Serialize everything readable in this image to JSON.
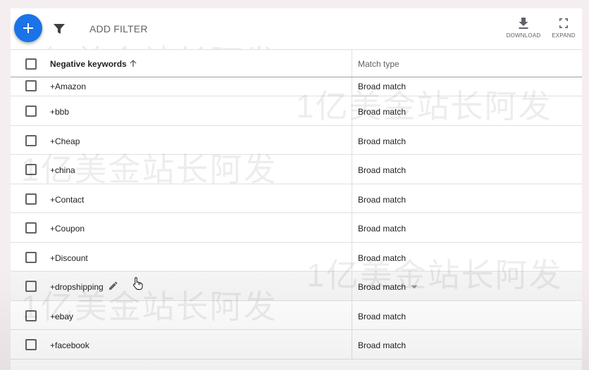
{
  "toolbar": {
    "add_label": "+",
    "add_filter_label": "ADD FILTER",
    "download_label": "DOWNLOAD",
    "expand_label": "EXPAND"
  },
  "table": {
    "columns": [
      "Negative keywords",
      "Match type"
    ],
    "rows": [
      {
        "keyword": "+Amazon",
        "match": "Broad match"
      },
      {
        "keyword": "+bbb",
        "match": "Broad match"
      },
      {
        "keyword": "+Cheap",
        "match": "Broad match"
      },
      {
        "keyword": "+china",
        "match": "Broad match"
      },
      {
        "keyword": "+Contact",
        "match": "Broad match"
      },
      {
        "keyword": "+Coupon",
        "match": "Broad match"
      },
      {
        "keyword": "+Discount",
        "match": "Broad match"
      },
      {
        "keyword": "+dropshipping",
        "match": "Broad match"
      },
      {
        "keyword": "+ebay",
        "match": "Broad match"
      },
      {
        "keyword": "+facebook",
        "match": "Broad match"
      }
    ]
  },
  "watermark": "1亿美金站长阿发",
  "colors": {
    "accent": "#1a73e8",
    "text": "#202124",
    "muted": "#5f6368",
    "divider": "#e0e0e0"
  },
  "icons": {
    "add": "plus-icon",
    "filter": "filter-icon",
    "download": "download-icon",
    "expand": "expand-icon",
    "sort": "arrow-up-icon",
    "edit": "pencil-icon",
    "dropdown": "caret-down-icon",
    "cursor": "hand-pointer-icon"
  }
}
